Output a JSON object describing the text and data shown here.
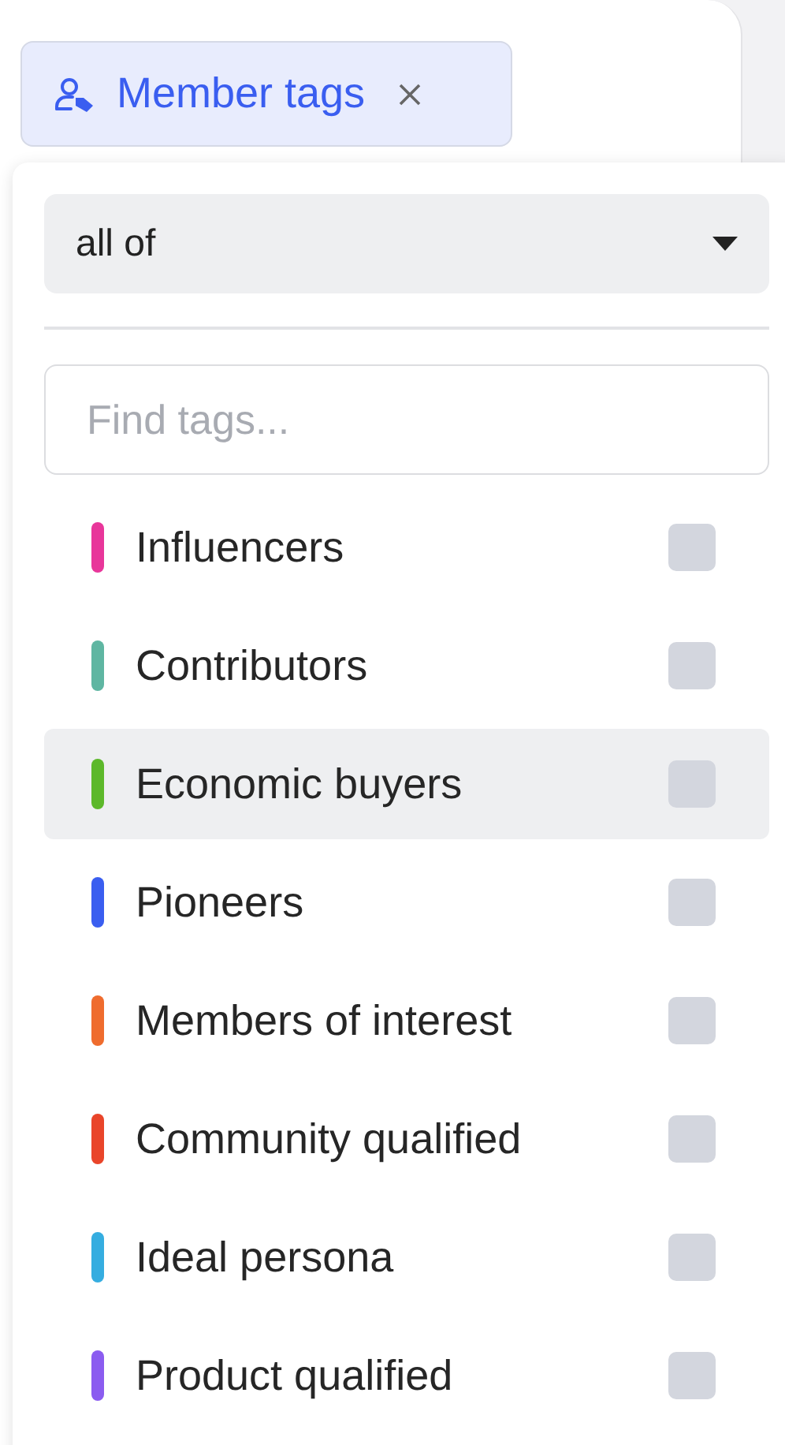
{
  "filter_chip": {
    "label": "Member tags"
  },
  "dropdown": {
    "match_mode": "all of",
    "search": {
      "placeholder": "Find tags..."
    },
    "tags": [
      {
        "label": "Influencers",
        "color": "#e8369a",
        "checked": false,
        "selected": false
      },
      {
        "label": "Contributors",
        "color": "#5fb6a2",
        "checked": false,
        "selected": false
      },
      {
        "label": "Economic buyers",
        "color": "#5cb82a",
        "checked": false,
        "selected": true
      },
      {
        "label": "Pioneers",
        "color": "#3a5ef0",
        "checked": false,
        "selected": false
      },
      {
        "label": "Members of interest",
        "color": "#ef6c2e",
        "checked": false,
        "selected": false
      },
      {
        "label": "Community qualified",
        "color": "#e9452a",
        "checked": false,
        "selected": false
      },
      {
        "label": "Ideal persona",
        "color": "#35ade0",
        "checked": false,
        "selected": false
      },
      {
        "label": "Product qualified",
        "color": "#8b5cf0",
        "checked": false,
        "selected": false
      }
    ]
  }
}
